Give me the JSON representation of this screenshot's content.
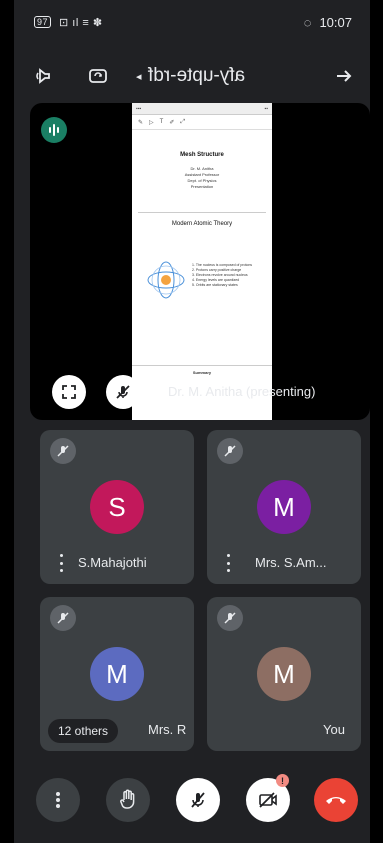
{
  "status_bar": {
    "left_text": "⊡ ıl ≡ ✽",
    "time": "10:07",
    "battery": "97"
  },
  "header": {
    "meeting_name": "afy-upte-rdf",
    "icons": [
      "back-arrow-icon",
      "dropdown-caret-icon",
      "switch-camera-icon",
      "audio-output-icon"
    ]
  },
  "presentation": {
    "presenter": "Dr. M. Anitha (presenting)",
    "slide": {
      "top_title": "Mesh Structure",
      "top_lines": [
        "Dr. M. Anitha",
        "Assistant Professor",
        "Dept. of Physics",
        "Presentation"
      ],
      "mid_title": "Modern Atomic Theory",
      "bullets": [
        "1. The nucleus is composed of protons",
        "2. Protons carry positive charge",
        "3. Electrons revolve around nucleus",
        "4. Energy levels are quantized",
        "5. Orbits are stationary states"
      ],
      "bottom_text": "Summary"
    }
  },
  "participants": [
    {
      "name": "S.Mahajothi",
      "initial": "S",
      "color": "#c2185b"
    },
    {
      "name": "Mrs. S.Am...",
      "initial": "M",
      "color": "#7b1fa2"
    },
    {
      "name": "Mrs. R",
      "initial": "M",
      "color": "#5c6bc0",
      "others": "12 others"
    },
    {
      "name": "You",
      "initial": "M",
      "color": "#8d6e63"
    }
  ],
  "controls": {
    "icons": [
      "more-options-icon",
      "raise-hand-icon",
      "mic-off-icon",
      "camera-off-icon",
      "end-call-icon"
    ],
    "camera_badge": "!"
  },
  "colors": {
    "background": "#202124",
    "tile": "#3c4043",
    "end_call": "#ea4335"
  }
}
